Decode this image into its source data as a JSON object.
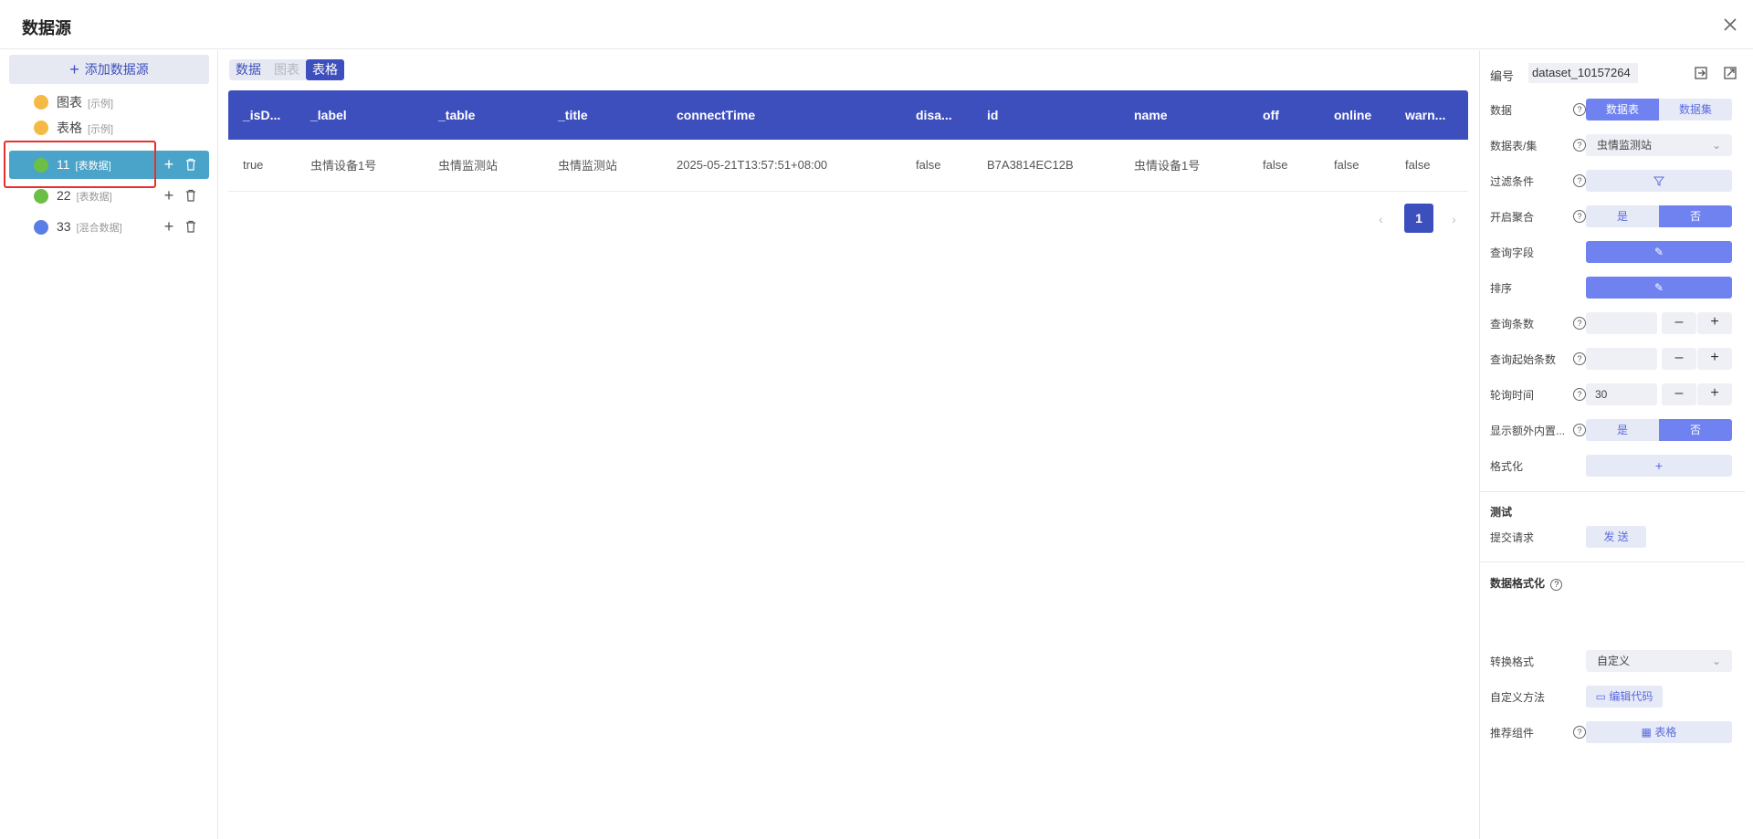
{
  "header": {
    "title": "数据源"
  },
  "sidebar": {
    "add_label": "添加数据源",
    "items": [
      {
        "name": "图表",
        "tag": "[示例]",
        "color": "#f5b945"
      },
      {
        "name": "表格",
        "tag": "[示例]",
        "color": "#f5b945"
      },
      {
        "name": "11",
        "tag": "[表数据]",
        "color": "#6cbf45"
      },
      {
        "name": "22",
        "tag": "[表数据]",
        "color": "#6cbf45"
      },
      {
        "name": "33",
        "tag": "[混合数据]",
        "color": "#5b7de6"
      }
    ]
  },
  "main": {
    "tabs": [
      "数据",
      "图表",
      "表格"
    ],
    "columns": [
      "_isD...",
      "_label",
      "_table",
      "_title",
      "connectTime",
      "disa...",
      "id",
      "name",
      "off",
      "online",
      "warn..."
    ],
    "rows": [
      [
        "true",
        "虫情设备1号",
        "虫情监测站",
        "虫情监测站",
        "2025-05-21T13:57:51+08:00",
        "false",
        "B7A3814EC12B",
        "虫情设备1号",
        "false",
        "false",
        "false"
      ]
    ],
    "page": "1"
  },
  "panel": {
    "code_label": "编号",
    "code_value": "dataset_10157264",
    "data_label": "数据",
    "data_opts": [
      "数据表",
      "数据集"
    ],
    "table_label": "数据表/集",
    "table_value": "虫情监测站",
    "filter_label": "过滤条件",
    "agg_label": "开启聚合",
    "yes": "是",
    "no": "否",
    "fields_label": "查询字段",
    "sort_label": "排序",
    "count_label": "查询条数",
    "start_label": "查询起始条数",
    "poll_label": "轮询时间",
    "poll_value": "30",
    "extra_label": "显示额外内置...",
    "format_label": "格式化",
    "test_title": "测试",
    "submit_label": "提交请求",
    "send_label": "发 送",
    "fmt_title": "数据格式化",
    "convert_label": "转换格式",
    "convert_value": "自定义",
    "custom_label": "自定义方法",
    "edit_code": "编辑代码",
    "recommend_label": "推荐组件",
    "recommend_value": "表格"
  }
}
